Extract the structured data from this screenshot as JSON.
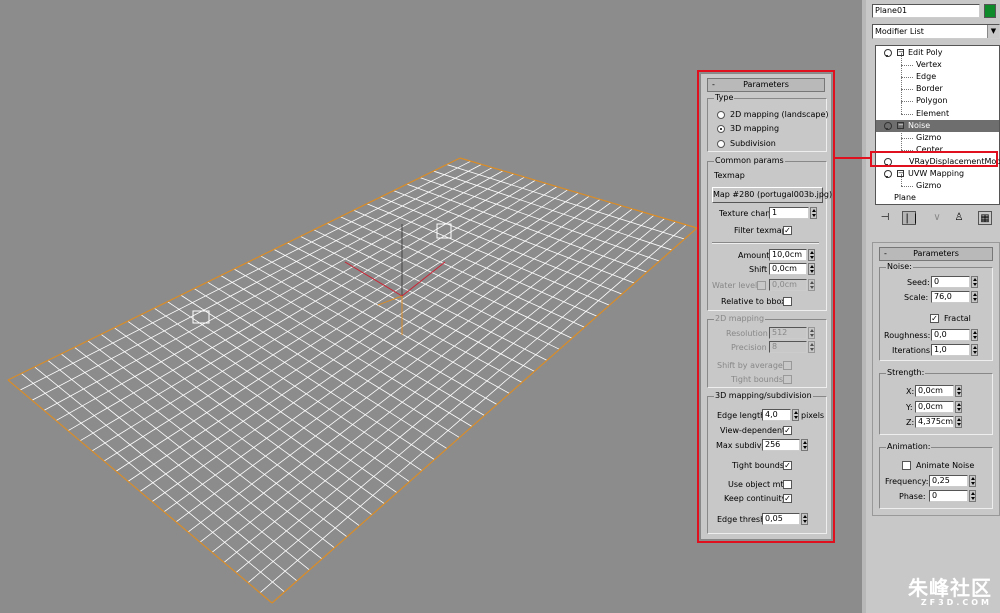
{
  "colors": {
    "viewport_bg": "#8c8c8c",
    "grid": "#ffffff",
    "edge": "#d98c28",
    "highlight": "#e0101e",
    "object_color": "#0e8a2a"
  },
  "object": {
    "name": "Plane01",
    "modifier_list": "Modifier List"
  },
  "stack": [
    {
      "label": "Edit Poly",
      "level": 0,
      "bulb": true,
      "box": true
    },
    {
      "label": "Vertex",
      "level": 1
    },
    {
      "label": "Edge",
      "level": 1
    },
    {
      "label": "Border",
      "level": 1
    },
    {
      "label": "Polygon",
      "level": 1
    },
    {
      "label": "Element",
      "level": 1
    },
    {
      "label": "Noise",
      "level": 0,
      "bulb": true,
      "box": true,
      "selected": true
    },
    {
      "label": "Gizmo",
      "level": 1
    },
    {
      "label": "Center",
      "level": 1
    },
    {
      "label": "VRayDisplacementMod",
      "level": 0,
      "bulb": true,
      "highlighted": true
    },
    {
      "label": "UVW Mapping",
      "level": 0,
      "bulb": true,
      "box": true
    },
    {
      "label": "Gizmo",
      "level": 1
    },
    {
      "label": "Plane",
      "level": 0
    }
  ],
  "toolbar_icons": [
    "pin-stack-icon",
    "show-end-result-icon",
    "make-unique-icon",
    "remove-modifier-icon",
    "configure-sets-icon"
  ],
  "noise": {
    "header": "Parameters",
    "noise_group": "Noise:",
    "seed_label": "Seed:",
    "seed": "0",
    "scale_label": "Scale:",
    "scale": "76,0",
    "fractal_label": "Fractal",
    "fractal": true,
    "roughness_label": "Roughness:",
    "roughness": "0,0",
    "iterations_label": "Iterations:",
    "iterations": "1,0",
    "strength_group": "Strength:",
    "x_label": "X:",
    "x": "0,0cm",
    "y_label": "Y:",
    "y": "0,0cm",
    "z_label": "Z:",
    "z": "4,375cm",
    "animation_group": "Animation:",
    "animate_label": "Animate Noise",
    "animate": false,
    "frequency_label": "Frequency:",
    "frequency": "0,25",
    "phase_label": "Phase:",
    "phase": "0"
  },
  "vray": {
    "header": "Parameters",
    "type_group": "Type",
    "type_options": [
      "2D mapping (landscape)",
      "3D mapping",
      "Subdivision"
    ],
    "type_selected": 1,
    "common_group": "Common params",
    "texmap_label": "Texmap",
    "texmap_button": "Map #280 (portugal003b.jpg)",
    "texture_chan_label": "Texture chan",
    "texture_chan": "1",
    "filter_texmap_label": "Filter texmap",
    "filter_texmap": true,
    "amount_label": "Amount",
    "amount": "10,0cm",
    "shift_label": "Shift",
    "shift": "0,0cm",
    "water_level_label": "Water level",
    "water_level": "0,0cm",
    "relative_label": "Relative to bbox",
    "mapping2d_group": "2D mapping",
    "resolution_label": "Resolution",
    "resolution": "512",
    "precision_label": "Precision",
    "precision": "8",
    "shift_avg_label": "Shift by average",
    "tight_bounds_2d_label": "Tight bounds",
    "mapping3d_group": "3D mapping/subdivision",
    "edge_length_label": "Edge length",
    "edge_length": "4,0",
    "pixels_label": "pixels",
    "view_dependent_label": "View-dependent",
    "view_dependent": true,
    "max_subdivs_label": "Max subdivs",
    "max_subdivs": "256",
    "tight_bounds_label": "Tight bounds",
    "tight_bounds": true,
    "use_object_mtl_label": "Use object mtl",
    "use_object_mtl": false,
    "keep_continuity_label": "Keep continuity",
    "keep_continuity": true,
    "edge_thresh_label": "Edge thresh",
    "edge_thresh": "0,05"
  },
  "watermark": {
    "name": "朱峰社区",
    "url": "ZF3D.COM"
  }
}
